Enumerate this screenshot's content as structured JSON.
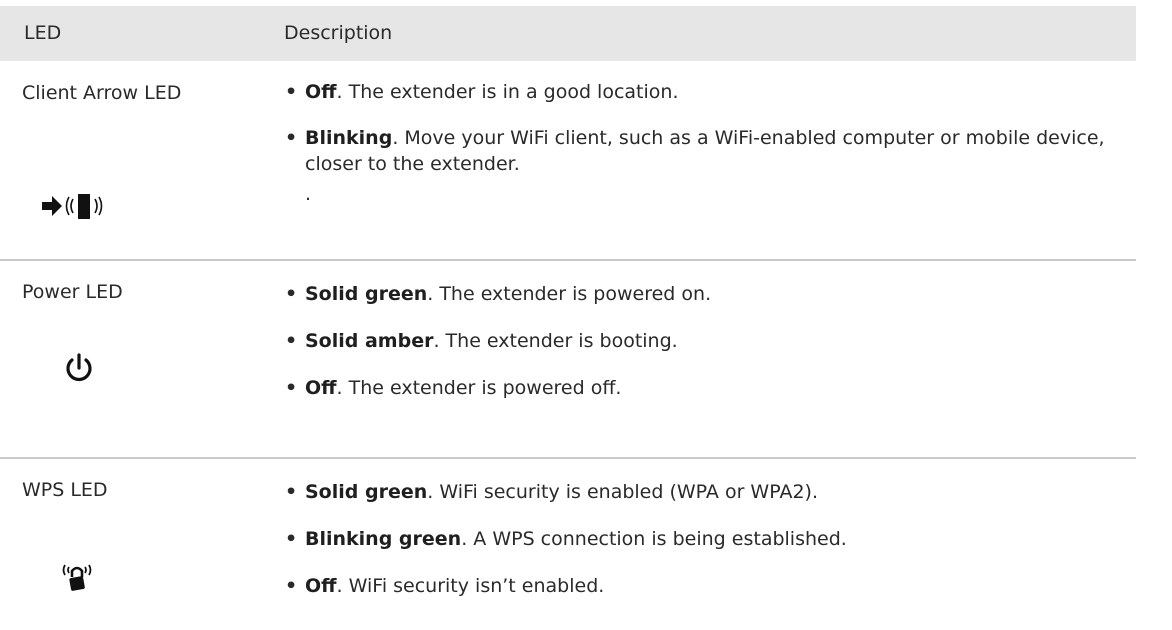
{
  "header": {
    "col1": "LED",
    "col2": "Description"
  },
  "rows": [
    {
      "label": "Client Arrow LED",
      "icon": "client-arrow-icon",
      "bullets": [
        {
          "bold": "Off",
          "text": ". The extender is in a good location."
        },
        {
          "bold": "Blinking",
          "text": ". Move your WiFi client, such as a WiFi-enabled computer or mobile device, closer to the extender."
        }
      ],
      "trailing": "."
    },
    {
      "label": "Power LED",
      "icon": "power-icon",
      "bullets": [
        {
          "bold": "Solid green",
          "text": ". The extender is powered on."
        },
        {
          "bold": "Solid amber",
          "text": ". The extender is booting."
        },
        {
          "bold": "Off",
          "text": ". The extender is powered off."
        }
      ]
    },
    {
      "label": "WPS LED",
      "icon": "wps-lock-icon",
      "bullets": [
        {
          "bold": "Solid green",
          "text": ". WiFi security is enabled (WPA or WPA2)."
        },
        {
          "bold": "Blinking green",
          "text": ". A WPS connection is being established."
        },
        {
          "bold": "Off",
          "text": ". WiFi security isn’t enabled."
        }
      ]
    }
  ],
  "bullet_symbol": "•"
}
